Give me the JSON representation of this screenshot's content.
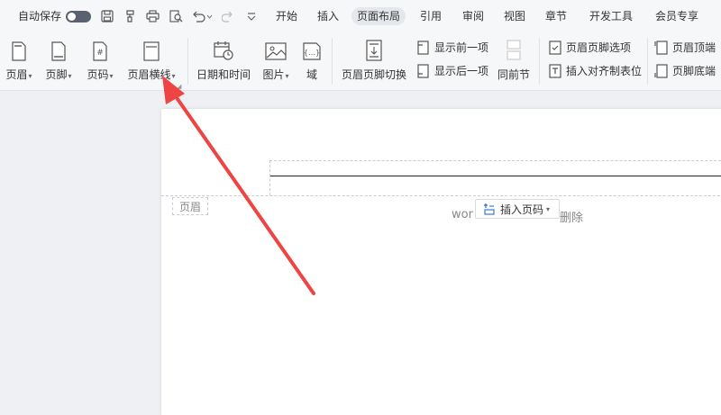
{
  "quickbar": {
    "autosave_label": "自动保存"
  },
  "tabs": [
    {
      "label": "开始"
    },
    {
      "label": "插入"
    },
    {
      "label": "页面布局"
    },
    {
      "label": "引用"
    },
    {
      "label": "审阅"
    },
    {
      "label": "视图"
    },
    {
      "label": "章节"
    },
    {
      "label": "开发工具"
    },
    {
      "label": "会员专享"
    }
  ],
  "active_tab": "页面布局",
  "ribbon": {
    "header_label": "页眉",
    "footer_label": "页脚",
    "page_number_label": "页码",
    "header_line_label": "页眉横线",
    "datetime_label": "日期和时间",
    "picture_label": "图片",
    "field_label": "域",
    "switch_label": "页眉页脚切换",
    "show_prev_label": "显示前一项",
    "show_next_label": "显示后一项",
    "same_as_prev_label": "同前节",
    "options_label": "页眉页脚选项",
    "insert_align_tab_label": "插入对齐制表位",
    "header_top_label": "页眉顶端",
    "footer_bottom_label": "页脚底端"
  },
  "document": {
    "header_tag": "页眉",
    "text_prefix": "wor",
    "insert_page_number_label": "插入页码",
    "delete_label": "删除"
  },
  "colors": {
    "arrow": "#ee4444",
    "active_tab_bg": "#e4e7ec",
    "accent": "#2b6bd1"
  }
}
